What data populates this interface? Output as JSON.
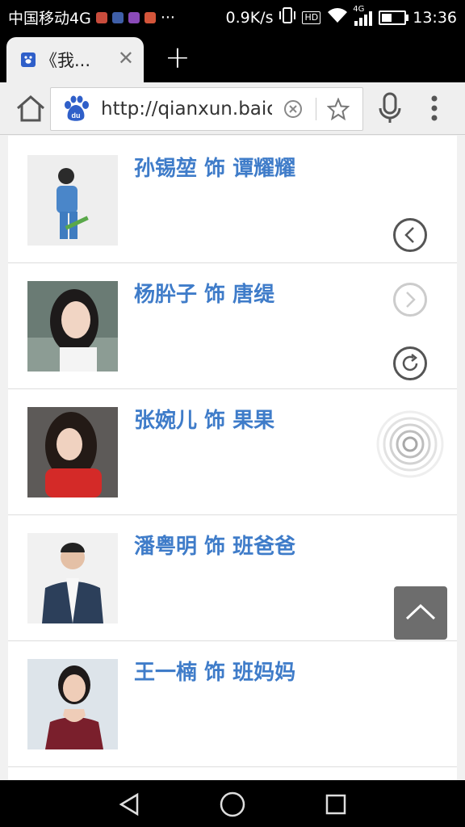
{
  "status_bar": {
    "carrier": "中国移动4G",
    "speed": "0.9K/s",
    "hd": "HD",
    "network_type": "4G",
    "time": "13:36",
    "battery_level": 0.45,
    "overflow": "···"
  },
  "browser": {
    "tab_title": "《我...",
    "url": "http://qianxun.baic",
    "site_icon": "du"
  },
  "cast": [
    {
      "name": "孙锡堃 饰 谭耀耀",
      "photo_bg": "#eeeeee"
    },
    {
      "name": "杨肸子 饰 唐缇",
      "photo_bg": "#6a7b74"
    },
    {
      "name": "张婉儿 饰 果果",
      "photo_bg": "#5d5a58"
    },
    {
      "name": "潘粤明 饰 班爸爸",
      "photo_bg": "#f1f1f1"
    },
    {
      "name": "王一楠 饰 班妈妈",
      "photo_bg": "#dde4ea"
    }
  ],
  "colors": {
    "link_blue": "#3f7cc9",
    "status_bg": "#000000"
  }
}
